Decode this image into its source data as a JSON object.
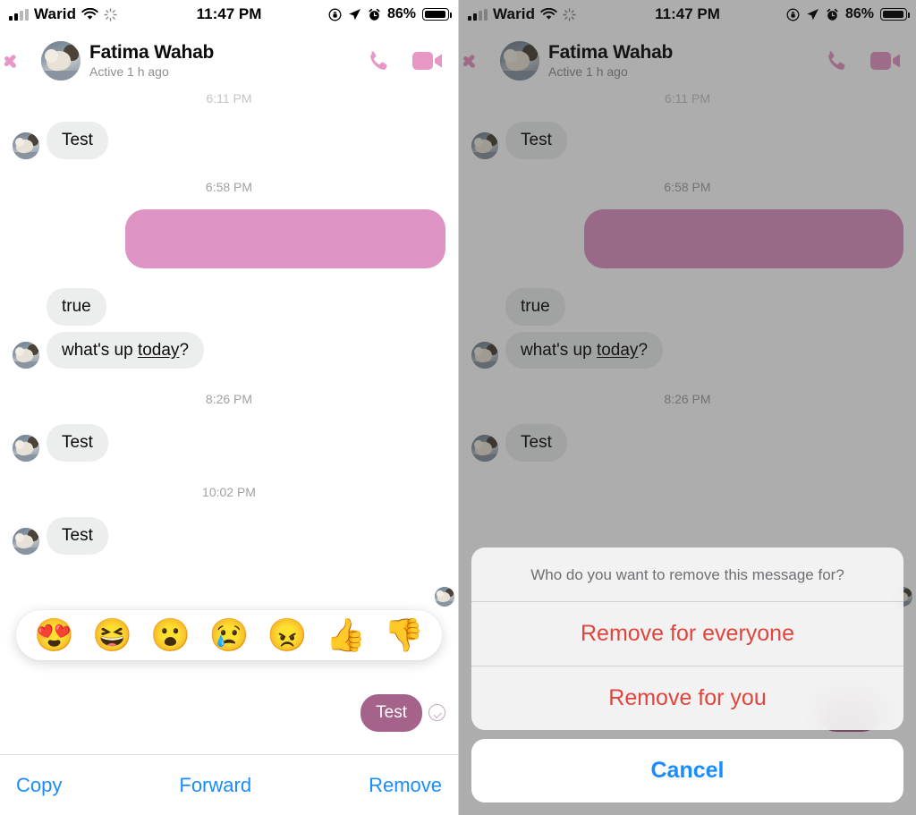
{
  "status_bar": {
    "carrier": "Warid",
    "time": "11:47 PM",
    "battery_percent": "86%",
    "icons": [
      "signal-bars-icon",
      "wifi-icon",
      "sync-spinner-icon",
      "rotation-lock-icon",
      "location-arrow-icon",
      "alarm-clock-icon",
      "battery-icon"
    ]
  },
  "header": {
    "back_icon": "back-chevron-icon",
    "avatar": "contact-avatar",
    "title": "Fatima Wahab",
    "subtitle": "Active 1 h ago",
    "call_icon": "phone-icon",
    "video_icon": "video-camera-icon",
    "accent_color": "#e796c6"
  },
  "conversation": {
    "messages": [
      {
        "type": "timestamp",
        "text": "6:11 PM",
        "clipped": true
      },
      {
        "type": "incoming",
        "text": "Test",
        "avatar": true
      },
      {
        "type": "timestamp",
        "text": "6:58 PM"
      },
      {
        "type": "outgoing-redacted",
        "text": "",
        "color": "#dd94c4"
      },
      {
        "type": "incoming",
        "text": "true",
        "avatar": false
      },
      {
        "type": "incoming-link",
        "text": "what's up today?",
        "link_text": "today",
        "avatar": true
      },
      {
        "type": "timestamp",
        "text": "8:26 PM"
      },
      {
        "type": "incoming",
        "text": "Test",
        "avatar": true
      },
      {
        "type": "timestamp",
        "text": "10:02 PM"
      },
      {
        "type": "incoming",
        "text": "Test",
        "avatar": true
      }
    ],
    "selected_message": {
      "text": "Test",
      "color": "#a5628a",
      "delivery_icon": "delivered-check-icon"
    }
  },
  "reactions": {
    "items": [
      {
        "name": "heart-eyes-reaction",
        "glyph": "😍"
      },
      {
        "name": "laughing-reaction",
        "glyph": "😆"
      },
      {
        "name": "surprised-reaction",
        "glyph": "😮"
      },
      {
        "name": "sad-reaction",
        "glyph": "😢"
      },
      {
        "name": "angry-reaction",
        "glyph": "😠"
      },
      {
        "name": "thumbs-up-reaction",
        "glyph": "👍"
      },
      {
        "name": "thumbs-down-reaction",
        "glyph": "👎"
      }
    ]
  },
  "action_bar": {
    "copy_label": "Copy",
    "forward_label": "Forward",
    "remove_label": "Remove",
    "accent_color": "#1a8cff"
  },
  "action_sheet": {
    "title": "Who do you want to remove this message for?",
    "options": [
      {
        "label": "Remove for everyone",
        "color": "#e0453d"
      },
      {
        "label": "Remove for you",
        "color": "#e0453d"
      }
    ],
    "cancel_label": "Cancel",
    "cancel_color": "#1a8cff"
  }
}
